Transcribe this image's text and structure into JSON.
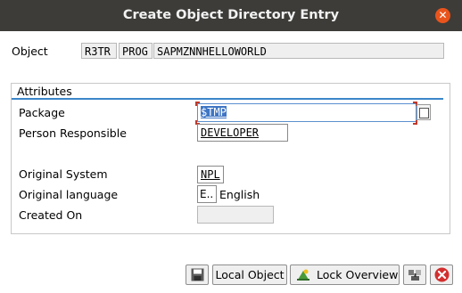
{
  "window": {
    "title": "Create Object Directory Entry",
    "close_glyph": "✕"
  },
  "object_row": {
    "label": "Object",
    "pgmid": "R3TR",
    "object_type": "PROG",
    "object_name": "SAPMZNNHELLOWORLD"
  },
  "attributes": {
    "title": "Attributes",
    "package_label": "Package",
    "package_value": "$TMP",
    "person_label": "Person Responsible",
    "person_value": "DEVELOPER",
    "orig_system_label": "Original System",
    "orig_system_value": "NPL",
    "orig_lang_label": "Original language",
    "orig_lang_code": "E..",
    "orig_lang_text": "English",
    "created_on_label": "Created On",
    "created_on_value": ""
  },
  "toolbar": {
    "local_object_label": "Local Object",
    "lock_overview_label": "Lock Overview"
  },
  "icons": {
    "close": "close-icon",
    "value_help": "value-help-icon",
    "save": "save-icon",
    "lock_overview": "lock-overview-icon",
    "transport": "transport-icon",
    "cancel": "cancel-icon"
  },
  "colors": {
    "titlebar": "#3d3c38",
    "close_button": "#e9541c",
    "group_line": "#3b86c9",
    "focus_highlight": "#3f76c4",
    "cancel_red": "#d32f2f"
  }
}
